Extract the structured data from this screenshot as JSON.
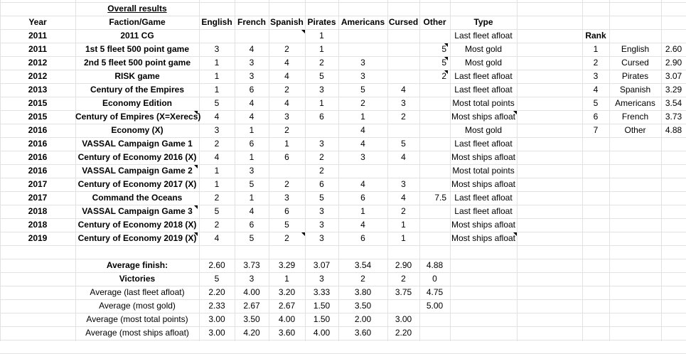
{
  "sheet": {
    "title": "Overall results",
    "headers": {
      "year": "Year",
      "game": "Faction/Game",
      "english": "English",
      "french": "French",
      "spanish": "Spanish",
      "pirates": "Pirates",
      "americans": "Americans",
      "cursed": "Cursed",
      "other": "Other",
      "type": "Type",
      "rank": "Rank"
    },
    "rows": [
      {
        "year": "2011",
        "game": "2011 CG",
        "english": "",
        "french": "",
        "spanish": "",
        "pirates": "1",
        "americans": "",
        "cursed": "",
        "other": "",
        "type": "Last fleet afloat"
      },
      {
        "year": "2011",
        "game": "1st 5 fleet 500 point game",
        "english": "3",
        "french": "4",
        "spanish": "2",
        "pirates": "1",
        "americans": "",
        "cursed": "",
        "other": "5",
        "type": "Most gold"
      },
      {
        "year": "2012",
        "game": "2nd 5 fleet 500 point game",
        "english": "1",
        "french": "3",
        "spanish": "4",
        "pirates": "2",
        "americans": "3",
        "cursed": "",
        "other": "5",
        "type": "Most gold"
      },
      {
        "year": "2012",
        "game": "RISK game",
        "english": "1",
        "french": "3",
        "spanish": "4",
        "pirates": "5",
        "americans": "3",
        "cursed": "",
        "other": "2",
        "type": "Last fleet afloat"
      },
      {
        "year": "2013",
        "game": "Century of the Empires",
        "english": "1",
        "french": "6",
        "spanish": "2",
        "pirates": "3",
        "americans": "5",
        "cursed": "4",
        "other": "",
        "type": "Last fleet afloat"
      },
      {
        "year": "2015",
        "game": "Economy Edition",
        "english": "5",
        "french": "4",
        "spanish": "4",
        "pirates": "1",
        "americans": "2",
        "cursed": "3",
        "other": "",
        "type": "Most total points"
      },
      {
        "year": "2015",
        "game": "Century of Empires (X=Xerecs)",
        "english": "4",
        "french": "4",
        "spanish": "3",
        "pirates": "6",
        "americans": "1",
        "cursed": "2",
        "other": "",
        "type": "Most ships afloat"
      },
      {
        "year": "2016",
        "game": "Economy (X)",
        "english": "3",
        "french": "1",
        "spanish": "2",
        "pirates": "",
        "americans": "4",
        "cursed": "",
        "other": "",
        "type": "Most gold"
      },
      {
        "year": "2016",
        "game": "VASSAL Campaign Game 1",
        "english": "2",
        "french": "6",
        "spanish": "1",
        "pirates": "3",
        "americans": "4",
        "cursed": "5",
        "other": "",
        "type": "Last fleet afloat"
      },
      {
        "year": "2016",
        "game": "Century of Economy 2016 (X)",
        "english": "4",
        "french": "1",
        "spanish": "6",
        "pirates": "2",
        "americans": "3",
        "cursed": "4",
        "other": "",
        "type": "Most ships afloat"
      },
      {
        "year": "2016",
        "game": "VASSAL Campaign Game 2",
        "english": "1",
        "french": "3",
        "spanish": "",
        "pirates": "2",
        "americans": "",
        "cursed": "",
        "other": "",
        "type": "Most total points"
      },
      {
        "year": "2017",
        "game": "Century of Economy 2017 (X)",
        "english": "1",
        "french": "5",
        "spanish": "2",
        "pirates": "6",
        "americans": "4",
        "cursed": "3",
        "other": "",
        "type": "Most ships afloat"
      },
      {
        "year": "2017",
        "game": "Command the Oceans",
        "english": "2",
        "french": "1",
        "spanish": "3",
        "pirates": "5",
        "americans": "6",
        "cursed": "4",
        "other": "7.5",
        "type": "Last fleet afloat"
      },
      {
        "year": "2018",
        "game": "VASSAL Campaign Game 3",
        "english": "5",
        "french": "4",
        "spanish": "6",
        "pirates": "3",
        "americans": "1",
        "cursed": "2",
        "other": "",
        "type": "Last fleet afloat"
      },
      {
        "year": "2018",
        "game": "Century of Economy 2018 (X)",
        "english": "2",
        "french": "6",
        "spanish": "5",
        "pirates": "3",
        "americans": "4",
        "cursed": "1",
        "other": "",
        "type": "Most ships afloat"
      },
      {
        "year": "2019",
        "game": "Century of Economy 2019 (X)",
        "english": "4",
        "french": "5",
        "spanish": "2",
        "pirates": "3",
        "americans": "6",
        "cursed": "1",
        "other": "",
        "type": "Most ships afloat"
      }
    ],
    "stats": [
      {
        "label": "Average finish:",
        "bold": true,
        "values": [
          "2.60",
          "3.73",
          "3.29",
          "3.07",
          "3.54",
          "2.90",
          "4.88"
        ]
      },
      {
        "label": "Victories",
        "bold": true,
        "values": [
          "5",
          "3",
          "1",
          "3",
          "2",
          "2",
          "0"
        ]
      },
      {
        "label": "Average (last fleet afloat)",
        "bold": false,
        "values": [
          "2.20",
          "4.00",
          "3.20",
          "3.33",
          "3.80",
          "3.75",
          "4.75"
        ]
      },
      {
        "label": "Average (most gold)",
        "bold": false,
        "values": [
          "2.33",
          "2.67",
          "2.67",
          "1.50",
          "3.50",
          "",
          "5.00"
        ]
      },
      {
        "label": "Average (most total points)",
        "bold": false,
        "values": [
          "3.00",
          "3.50",
          "4.00",
          "1.50",
          "2.00",
          "3.00",
          ""
        ]
      },
      {
        "label": "Average (most ships afloat)",
        "bold": false,
        "values": [
          "3.00",
          "4.20",
          "3.60",
          "4.00",
          "3.60",
          "2.20",
          ""
        ]
      }
    ],
    "ranking": [
      {
        "rank": "1",
        "faction": "English",
        "score": "2.60"
      },
      {
        "rank": "2",
        "faction": "Cursed",
        "score": "2.90"
      },
      {
        "rank": "3",
        "faction": "Pirates",
        "score": "3.07"
      },
      {
        "rank": "4",
        "faction": "Spanish",
        "score": "3.29"
      },
      {
        "rank": "5",
        "faction": "Americans",
        "score": "3.54"
      },
      {
        "rank": "6",
        "faction": "French",
        "score": "3.73"
      },
      {
        "rank": "7",
        "faction": "Other",
        "score": "4.88"
      }
    ],
    "colors": {
      "grid": "#e2e2e2",
      "text": "#000000",
      "background": "#ffffff"
    }
  }
}
